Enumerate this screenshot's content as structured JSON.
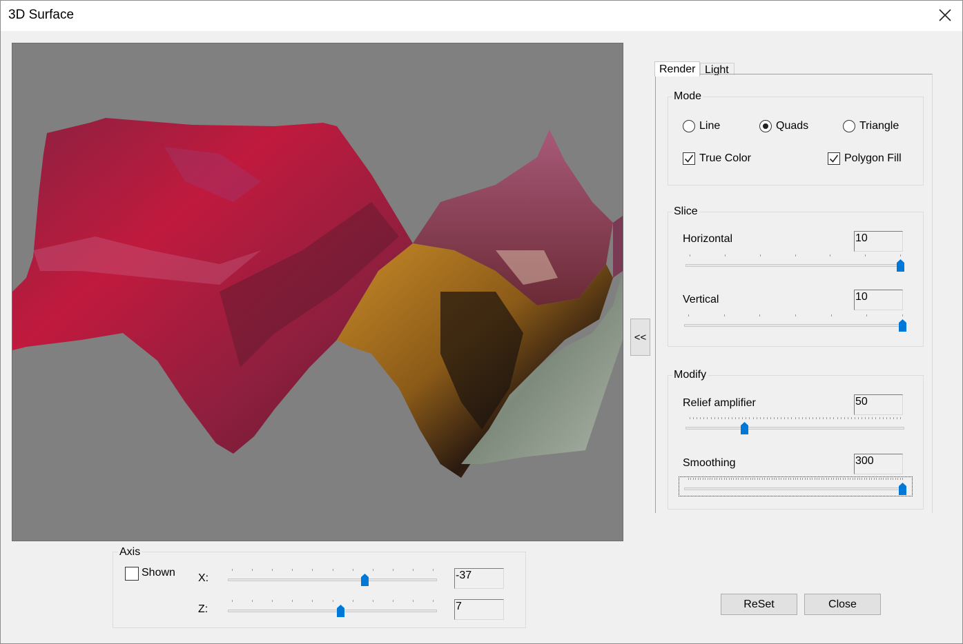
{
  "window": {
    "title": "3D Surface"
  },
  "collapse_label": "<<",
  "tabs": [
    {
      "label": "Render"
    },
    {
      "label": "Light"
    }
  ],
  "render": {
    "mode": {
      "label": "Mode",
      "options": [
        {
          "label": "Line",
          "selected": false
        },
        {
          "label": "Quads",
          "selected": true
        },
        {
          "label": "Triangle",
          "selected": false
        }
      ],
      "true_color": {
        "label": "True Color",
        "checked": true
      },
      "polygon_fill": {
        "label": "Polygon Fill",
        "checked": true
      }
    },
    "slice": {
      "label": "Slice",
      "horizontal": {
        "label": "Horizontal",
        "value": "10",
        "position": 1.0
      },
      "vertical": {
        "label": "Vertical",
        "value": "10",
        "position": 1.0
      }
    },
    "modify": {
      "label": "Modify",
      "relief": {
        "label": "Relief amplifier",
        "value": "50",
        "position": 0.26
      },
      "smoothing": {
        "label": "Smoothing",
        "value": "300",
        "position": 1.0
      }
    }
  },
  "axis": {
    "label": "Axis",
    "shown": {
      "label": "Shown",
      "checked": false
    },
    "x": {
      "label": "X:",
      "value": "-37",
      "position": 0.66
    },
    "z": {
      "label": "Z:",
      "value": "7",
      "position": 0.54
    }
  },
  "buttons": {
    "reset": "ReSet",
    "close": "Close"
  }
}
